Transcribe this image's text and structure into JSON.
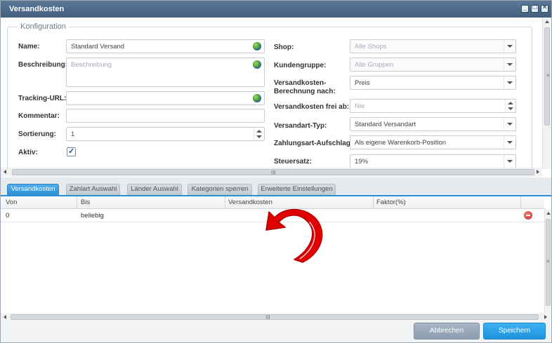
{
  "window": {
    "title": "Versandkosten"
  },
  "config": {
    "legend": "Konfiguration",
    "left": {
      "name": {
        "label": "Name:",
        "value": "Standard Versand"
      },
      "description": {
        "label": "Beschreibung:",
        "placeholder": "Beschreibung"
      },
      "tracking": {
        "label": "Tracking-URL:",
        "value": ""
      },
      "comment": {
        "label": "Kommentar:",
        "value": ""
      },
      "sort": {
        "label": "Sortierung:",
        "value": "1"
      },
      "active": {
        "label": "Aktiv:",
        "checked": true
      }
    },
    "right": {
      "shop": {
        "label": "Shop:",
        "placeholder": "Alle Shops"
      },
      "customer_group": {
        "label": "Kundengruppe:",
        "placeholder": "Alle Gruppen"
      },
      "calc_by": {
        "label_line1": "Versandkosten-",
        "label_line2": "Berechnung nach:",
        "value": "Preis"
      },
      "free_from": {
        "label": "Versandkosten frei ab:",
        "placeholder": "Nie"
      },
      "type": {
        "label": "Versandart-Typ:",
        "value": "Standard Versandart"
      },
      "surcharge": {
        "label": "Zahlungsart-Aufschlag:",
        "value": "Als eigene Warenkorb-Position"
      },
      "tax": {
        "label": "Steuersatz:",
        "value": "19%"
      }
    }
  },
  "tabs": [
    {
      "label": "Versandkosten",
      "active": true
    },
    {
      "label": "Zahlart Auswahl",
      "active": false
    },
    {
      "label": "Länder Auswahl",
      "active": false
    },
    {
      "label": "Kategorien sperren",
      "active": false
    },
    {
      "label": "Erweiterte Einstellungen",
      "active": false
    }
  ],
  "grid": {
    "columns": [
      "Von",
      "Bis",
      "Versandkosten",
      "Faktor(%)"
    ],
    "rows": [
      {
        "von": "0",
        "bis": "beliebig",
        "versandkosten": "",
        "faktor": ""
      }
    ]
  },
  "buttons": {
    "cancel": "Abbrechen",
    "save": "Speichern"
  },
  "colors": {
    "accent": "#2a8fd4",
    "titlebar": "#4e6b8a",
    "annotation_arrow": "#e00000"
  },
  "icons": {
    "minimize": "minimize-icon",
    "maximize": "maximize-icon",
    "close": "close-icon",
    "translate": "globe-icon",
    "delete": "delete-icon"
  }
}
